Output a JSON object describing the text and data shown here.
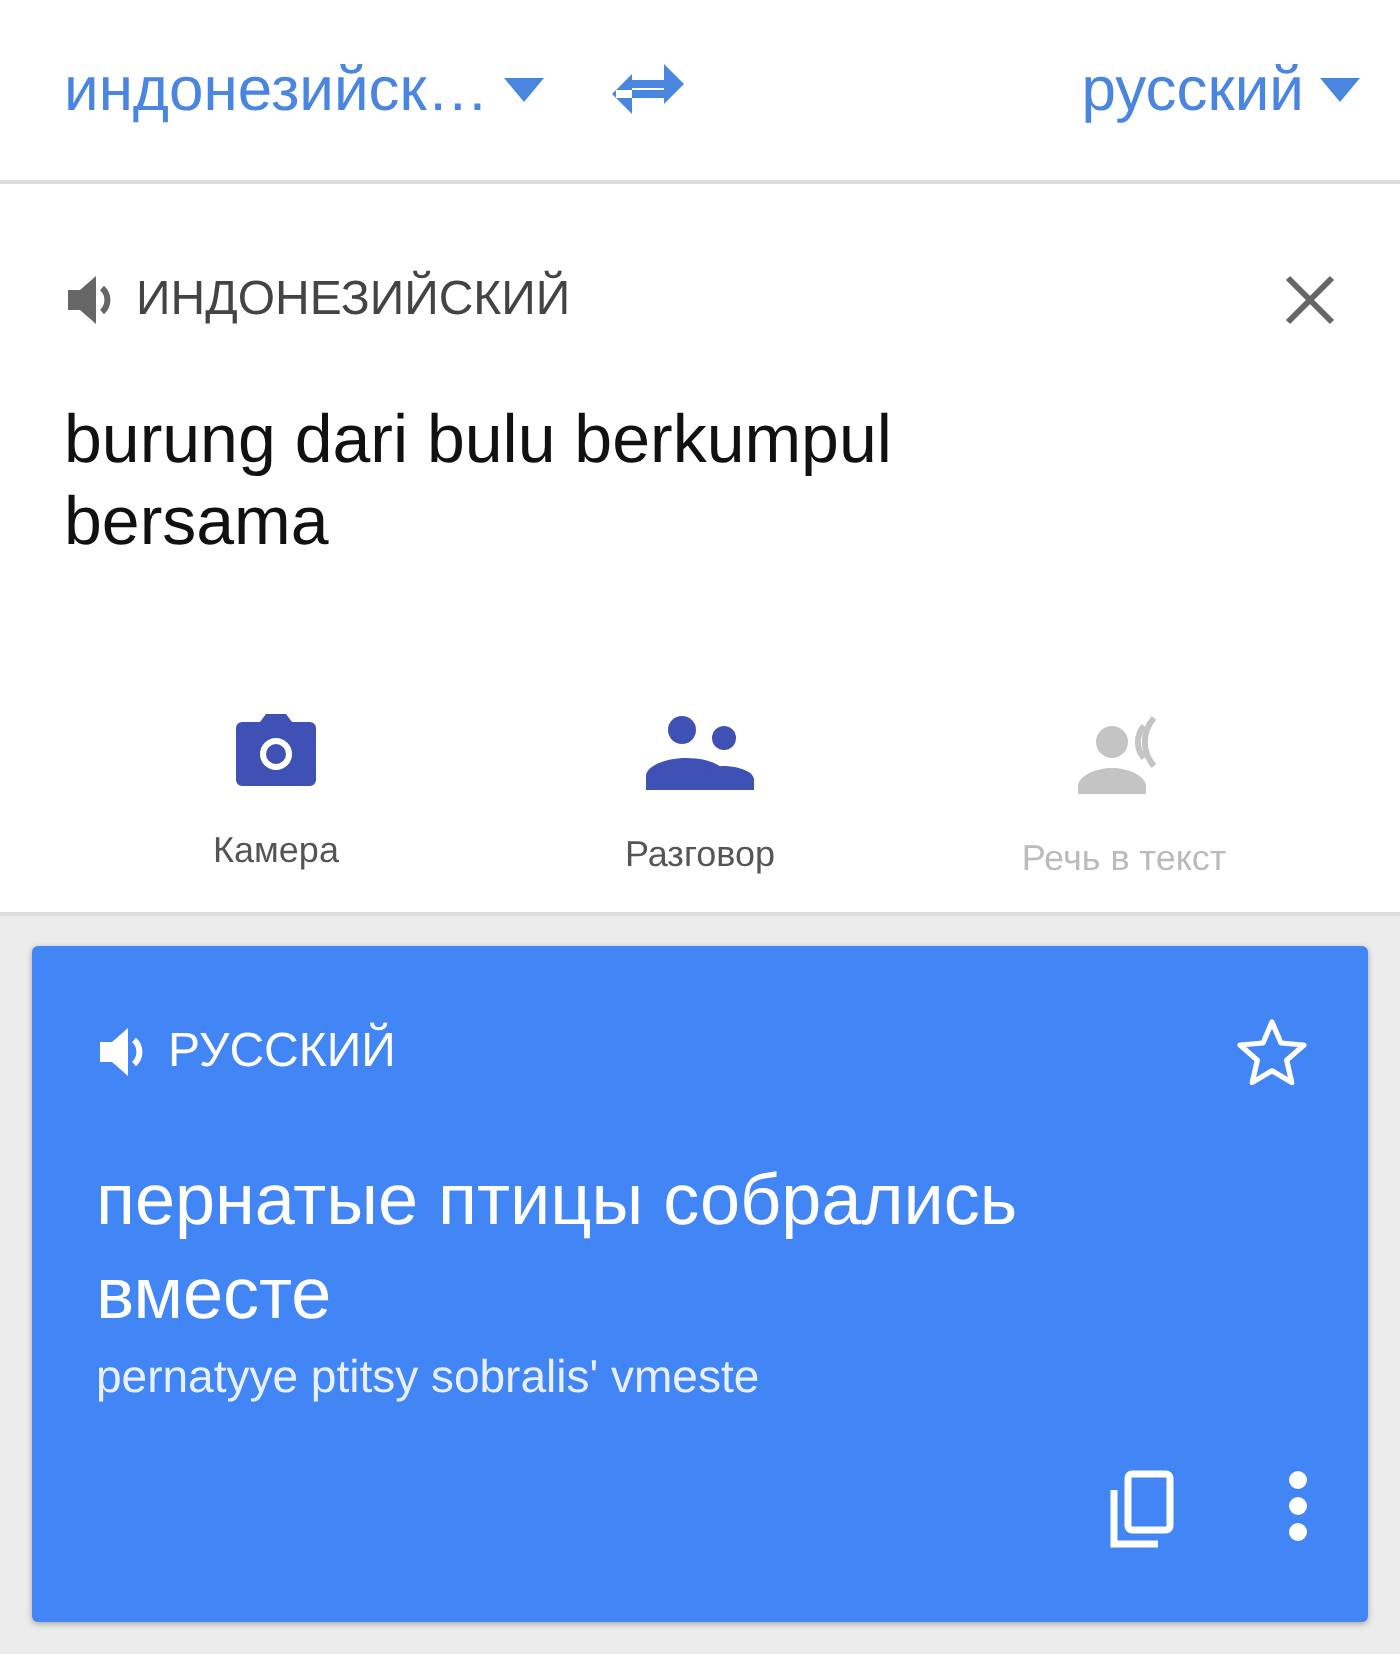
{
  "language_bar": {
    "source": "индонезийск…",
    "target": "русский"
  },
  "input": {
    "language": "ИНДОНЕЗИЙСКИЙ",
    "text": "burung dari bulu berkumpul bersama"
  },
  "tools": [
    {
      "kind": "camera",
      "label": "Камера",
      "disabled": false
    },
    {
      "kind": "conversation",
      "label": "Разговор",
      "disabled": false
    },
    {
      "kind": "speech",
      "label": "Речь в текст",
      "disabled": true
    }
  ],
  "result": {
    "language": "РУССКИЙ",
    "starred": false,
    "text": "пернатые птицы собрались вместе",
    "transliteration": "pernatyye ptitsy sobralis' vmeste"
  }
}
